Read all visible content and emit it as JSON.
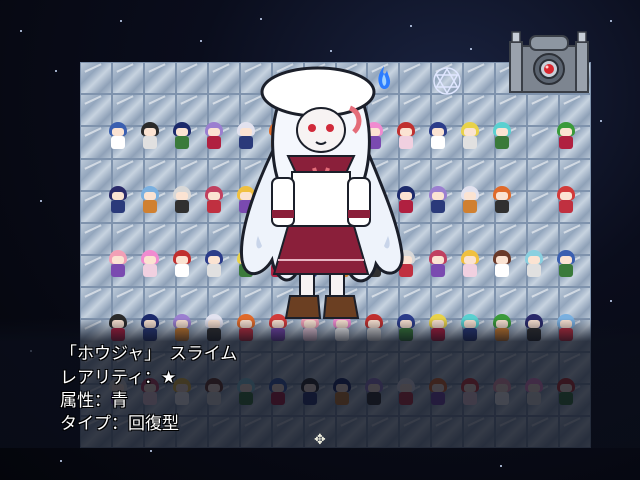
{
  "info": {
    "name_line": "「ホウジャ」　スライム",
    "rarity_label": "レアリティ：",
    "rarity_value": "★",
    "attribute_label": "属性：",
    "attribute_value": "青",
    "type_label": "タイプ：",
    "type_value": "回復型"
  },
  "icons": {
    "top_right_device": "stone-shrine-icon",
    "flame": "blue-flame-icon",
    "magic_circle": "hexagram-icon",
    "cursor": "cross-cursor-icon"
  },
  "colors": {
    "tile": "#a9b8ca",
    "text": "#ffffff",
    "background": "#05070f"
  }
}
